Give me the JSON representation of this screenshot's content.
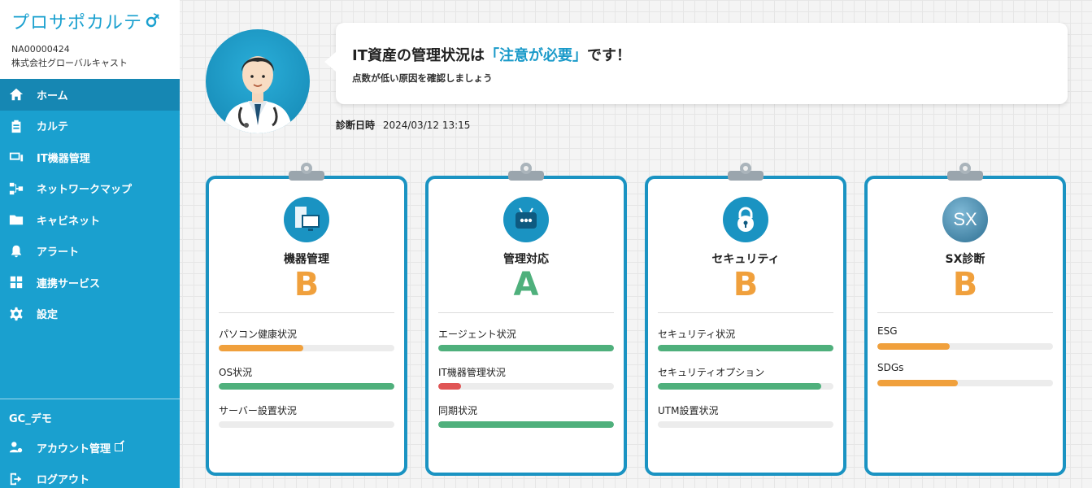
{
  "app": {
    "logo_text": "プロサポカルテ"
  },
  "tenant": {
    "id": "NA00000424",
    "name": "株式会社グローバルキャスト"
  },
  "nav": {
    "items": [
      {
        "label": "ホーム",
        "icon": "home-icon",
        "active": true
      },
      {
        "label": "カルテ",
        "icon": "clipboard-icon"
      },
      {
        "label": "IT機器管理",
        "icon": "devices-icon"
      },
      {
        "label": "ネットワークマップ",
        "icon": "network-icon"
      },
      {
        "label": "キャビネット",
        "icon": "folder-icon"
      },
      {
        "label": "アラート",
        "icon": "bell-icon"
      },
      {
        "label": "連携サービス",
        "icon": "grid-icon"
      },
      {
        "label": "設定",
        "icon": "gear-icon"
      }
    ]
  },
  "org": {
    "name": "GC_デモ",
    "account": "アカウント管理",
    "logout": "ログアウト"
  },
  "status": {
    "title_pre": "IT資産の管理状況は",
    "title_highlight": "「注意が必要」",
    "title_post": "です！",
    "subtitle": "点数が低い原因を確認しましょう",
    "date_label": "診断日時",
    "date_value": "2024/03/12 13:15"
  },
  "colors": {
    "sidebar": "#1aa0cf",
    "accent": "#1a93c2",
    "green": "#4fb07c",
    "orange": "#f0a03c",
    "red": "#e05555",
    "bar_bg": "#ececec"
  },
  "cards": [
    {
      "title": "機器管理",
      "grade": "B",
      "icon": "monitor-icon",
      "metrics": [
        {
          "label": "パソコン健康状況",
          "value": 0.48,
          "color": "#f0a03c"
        },
        {
          "label": "OS状況",
          "value": 1.0,
          "color": "#4fb07c"
        },
        {
          "label": "サーバー設置状況",
          "value": 0,
          "color": "#ececec"
        }
      ]
    },
    {
      "title": "管理対応",
      "grade": "A",
      "icon": "robot-icon",
      "metrics": [
        {
          "label": "エージェント状況",
          "value": 1.0,
          "color": "#4fb07c"
        },
        {
          "label": "IT機器管理状況",
          "value": 0.13,
          "color": "#e05555"
        },
        {
          "label": "同期状況",
          "value": 1.0,
          "color": "#4fb07c"
        }
      ]
    },
    {
      "title": "セキュリティ",
      "grade": "B",
      "icon": "lock-icon",
      "metrics": [
        {
          "label": "セキュリティ状況",
          "value": 1.0,
          "color": "#4fb07c"
        },
        {
          "label": "セキュリティオプション",
          "value": 0.93,
          "color": "#4fb07c"
        },
        {
          "label": "UTM設置状況",
          "value": 0,
          "color": "#ececec"
        }
      ]
    },
    {
      "title": "SX診断",
      "grade": "B",
      "icon": "sx-globe-icon",
      "icon_text": "SX",
      "metrics": [
        {
          "label": "ESG",
          "value": 0.41,
          "color": "#f0a03c"
        },
        {
          "label": "SDGs",
          "value": 0.46,
          "color": "#f0a03c"
        }
      ]
    }
  ]
}
